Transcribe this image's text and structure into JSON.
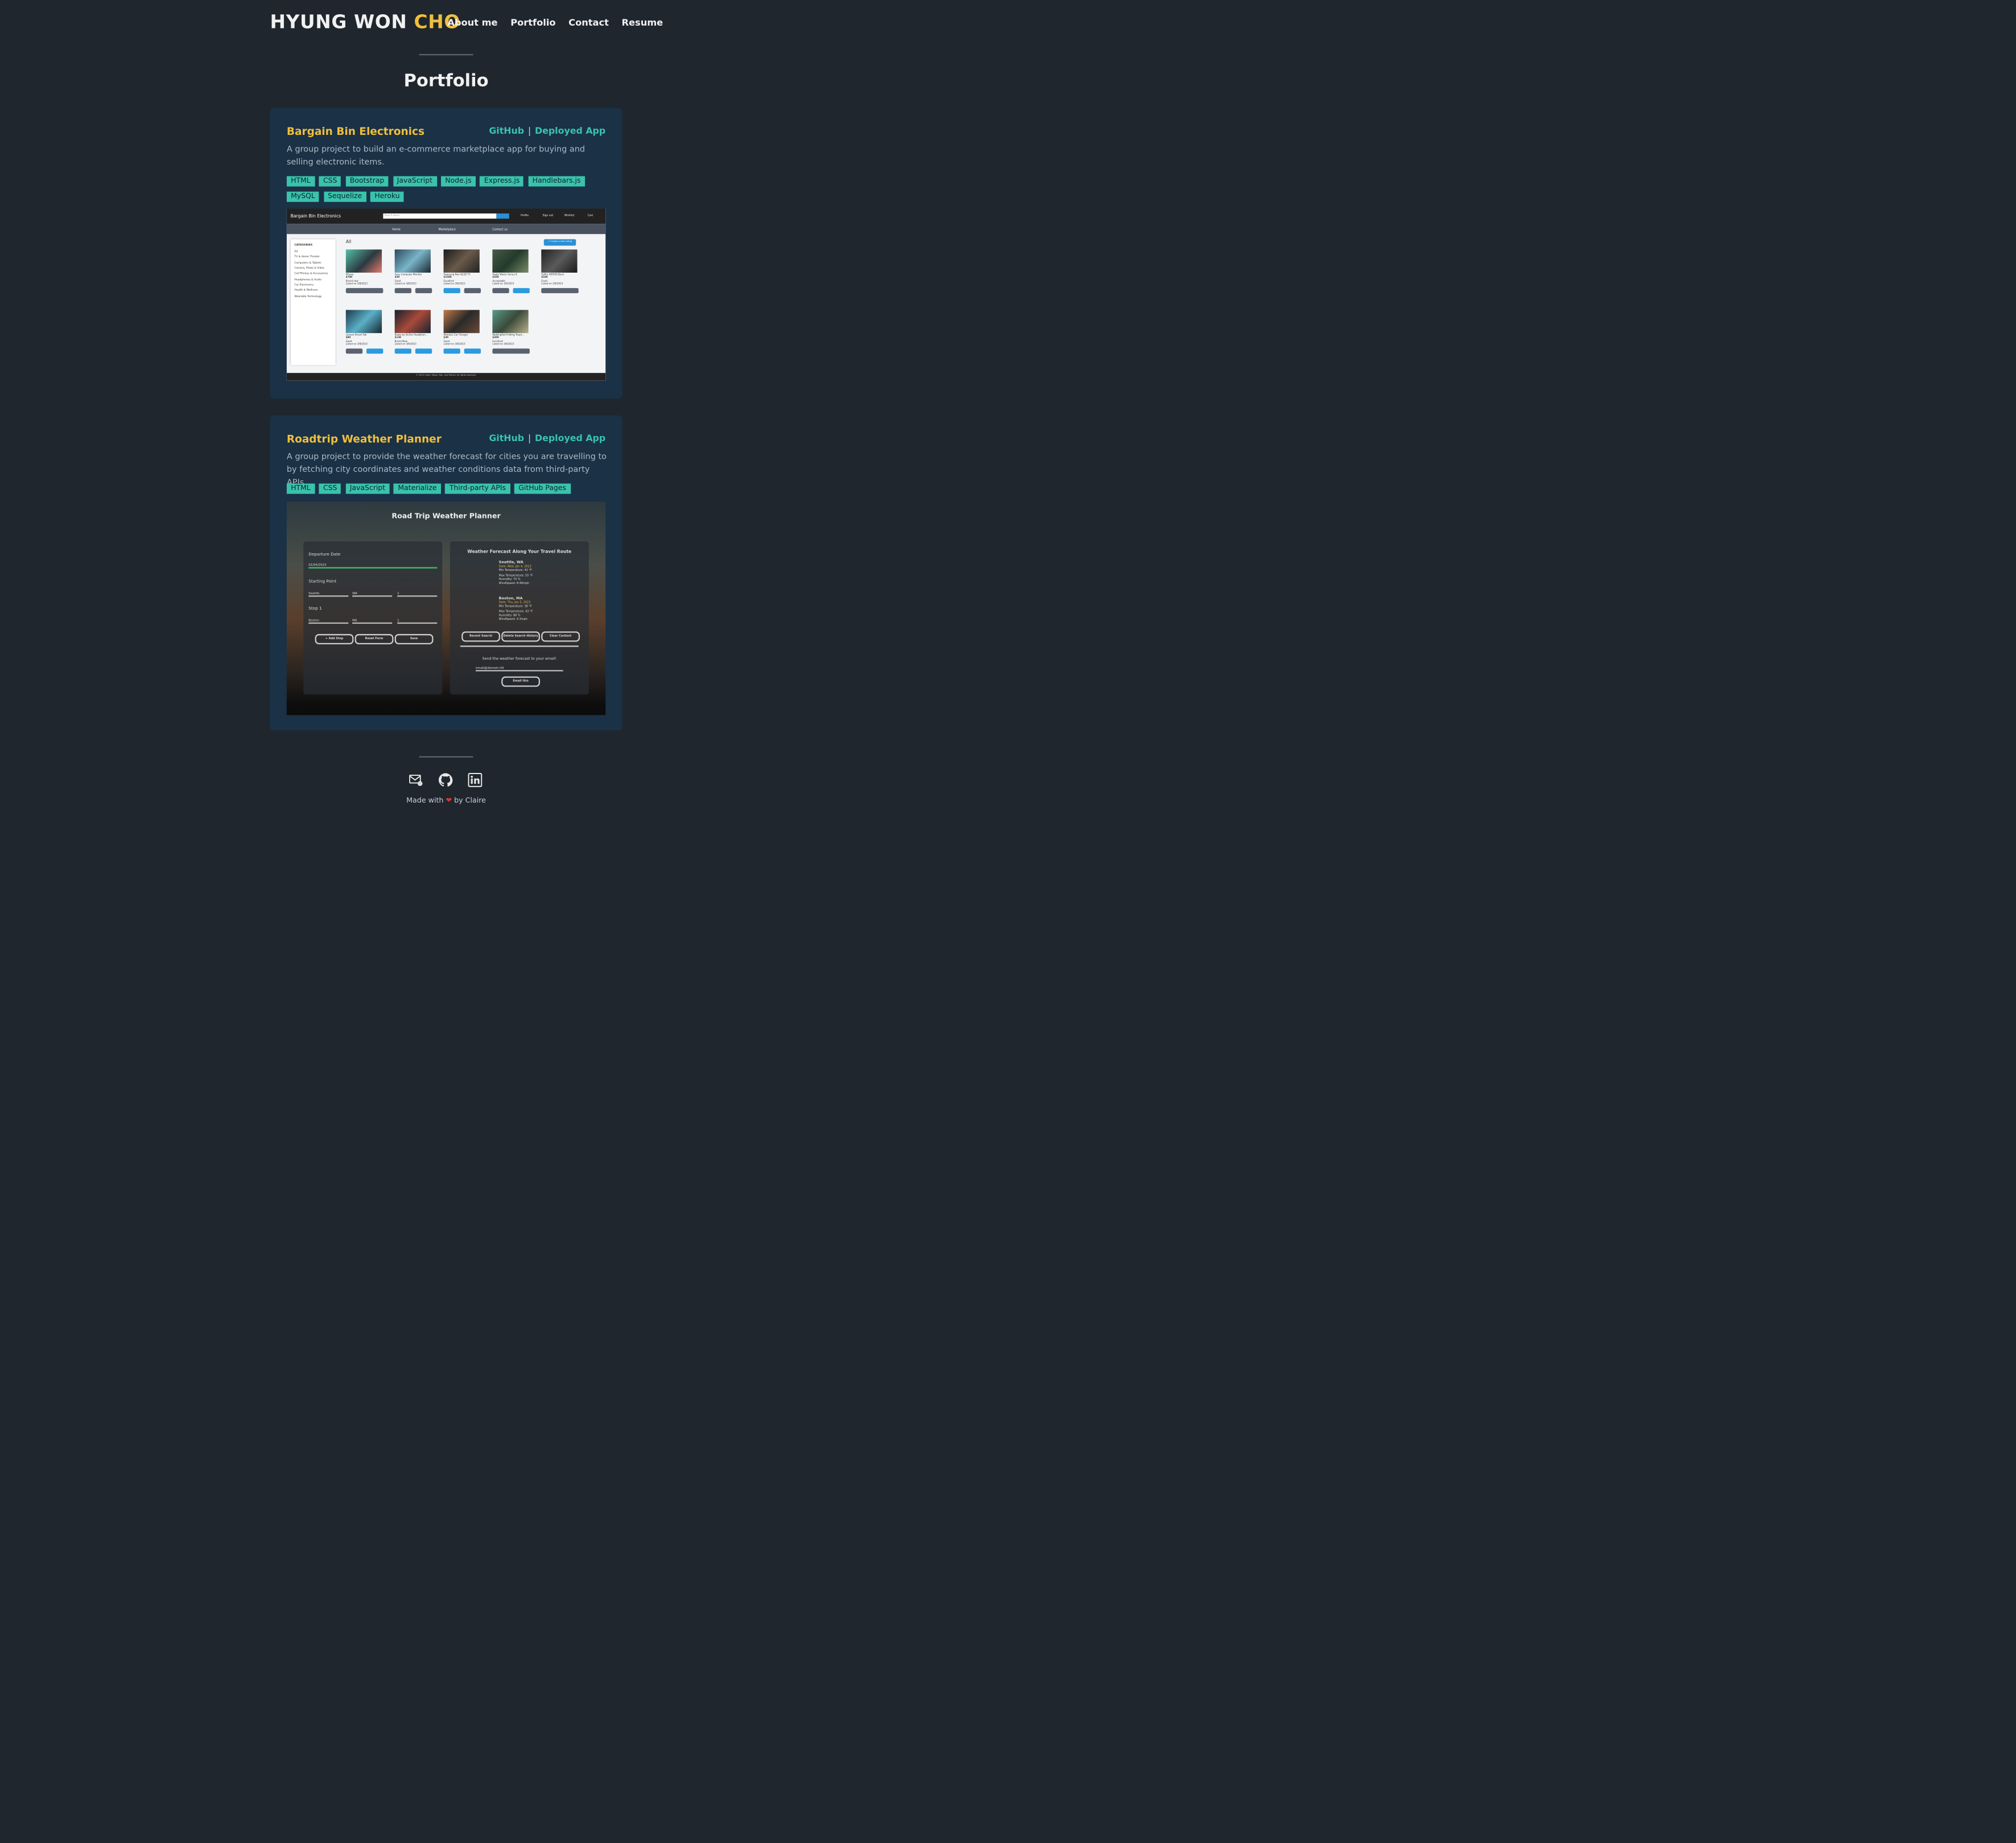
{
  "header": {
    "logo_main": "HYUNG WON ",
    "logo_accent": "CHO",
    "nav": [
      "About me",
      "Portfolio",
      "Contact",
      "Resume"
    ]
  },
  "page_title": "Portfolio",
  "projects": [
    {
      "title": "Bargain Bin Electronics",
      "github_label": "GitHub",
      "separator": "|",
      "deployed_label": "Deployed App",
      "description": "A group project to build an e-commerce marketplace app for buying and selling electronic items.",
      "tags": [
        "HTML",
        "CSS",
        "Bootstrap",
        "JavaScript",
        "Node.js",
        "Express.js",
        "Handlebars.js",
        "MySQL",
        "Sequelize",
        "Heroku"
      ],
      "screenshot": {
        "brand": "Bargain Bin Electronics",
        "search_placeholder": "Search items",
        "top_links": [
          "Profile",
          "Sign out",
          "Wishlist",
          "Cart"
        ],
        "sub_nav": [
          "Home",
          "Marketplace",
          "Contact us"
        ],
        "section_label": "All",
        "create_button": "+ Create a new listing",
        "categories_title": "CATEGORIES",
        "categories": [
          "All",
          "TV & Home Theater",
          "Computers & Tablets",
          "Camera, Photo & Video",
          "Cell Phones & Accessories",
          "Headphones & Audio",
          "Car Electronics",
          "Health & Wellness",
          "Wearable Technology"
        ],
        "items": [
          {
            "name": "iPhone",
            "price": "$700",
            "condition": "Brand new",
            "listed": "Listed on 3/8/2023"
          },
          {
            "name": "Asus Computer Monitor",
            "price": "$50",
            "condition": "Good",
            "listed": "Listed on 3/8/2023"
          },
          {
            "name": "Samsung Neo QLED TV",
            "price": "$1500",
            "condition": "Excellent",
            "listed": "Listed on 3/8/2023"
          },
          {
            "name": "Apple Watch Series 8",
            "price": "$100",
            "condition": "Acceptable",
            "listed": "Listed on 3/9/2023"
          },
          {
            "name": "GoPro HERO8 Black",
            "price": "$100",
            "condition": "Good",
            "listed": "Listed on 3/8/2023"
          },
          {
            "name": "Lenovo Smart Tab",
            "price": "$80",
            "condition": "Good",
            "listed": "Listed on 3/8/2023"
          },
          {
            "name": "Beats by Dr.Dre Headphon...",
            "price": "$130",
            "condition": "Brand New",
            "listed": "Listed on 3/8/2023"
          },
          {
            "name": "Wireless Car Charger",
            "price": "$30",
            "condition": "Good",
            "listed": "Listed on 3/8/2023"
          },
          {
            "name": "WalkingPad Folding Tread...",
            "price": "$200",
            "condition": "Excellent",
            "listed": "Listed on 3/8/2023"
          }
        ],
        "footer": "© 2023 Claire, Edgar, Ray, and Patrick. All rights reserved."
      }
    },
    {
      "title": "Roadtrip Weather Planner",
      "github_label": "GitHub",
      "separator": "|",
      "deployed_label": "Deployed App",
      "description": "A group project to provide the weather forecast for cities you are travelling to by fetching city coordinates and weather conditions data from third-party APIs.",
      "tags": [
        "HTML",
        "CSS",
        "JavaScript",
        "Materialize",
        "Third-party APIs",
        "GitHub Pages"
      ],
      "screenshot": {
        "heading": "Road Trip Weather Planner",
        "departure_label": "Departure Date",
        "departure_value": "01/04/2023",
        "start_label": "Starting Point",
        "start_city": "Seattle",
        "start_state": "WA",
        "start_days": "1",
        "stop_label": "Stop 1",
        "stop_city": "Boston",
        "stop_state": "MA",
        "stop_days": "1",
        "buttons": [
          "+ Add Stop",
          "Reset Form",
          "Save"
        ],
        "forecast_title": "Weather Forecast Along Your Travel Route",
        "cities": [
          {
            "city": "Seattle, WA",
            "date": "Date: Wed, Jan 4, 2023",
            "lines": [
              "Min Temperature: 42 °F",
              "Max Temperature: 55 °F",
              "Humidity: 75 %",
              "WindSpeed: 8.48mph"
            ]
          },
          {
            "city": "Boston, MA",
            "date": "Date: Thu, Jan 5, 2023",
            "lines": [
              "Min Temperature: 36 °F",
              "Max Temperature: 43 °F",
              "Humidity: 88 %",
              "WindSpeed: 4.3mph"
            ]
          }
        ],
        "right_buttons": [
          "Recent Search",
          "Delete Search History",
          "Clear Content"
        ],
        "email_prompt": "Send the weather forecast to your email!",
        "email_value": "email@domain.tld",
        "email_button": "Email this"
      }
    }
  ],
  "footer": {
    "icons": [
      "email-icon",
      "github-icon",
      "linkedin-icon"
    ],
    "made_prefix": "Made with",
    "heart": "❤",
    "made_suffix": "by Claire"
  },
  "colors": {
    "background": "#1f262d",
    "card": "#1a3146",
    "accent_yellow": "#f0bf3c",
    "accent_teal": "#39c3ac"
  }
}
